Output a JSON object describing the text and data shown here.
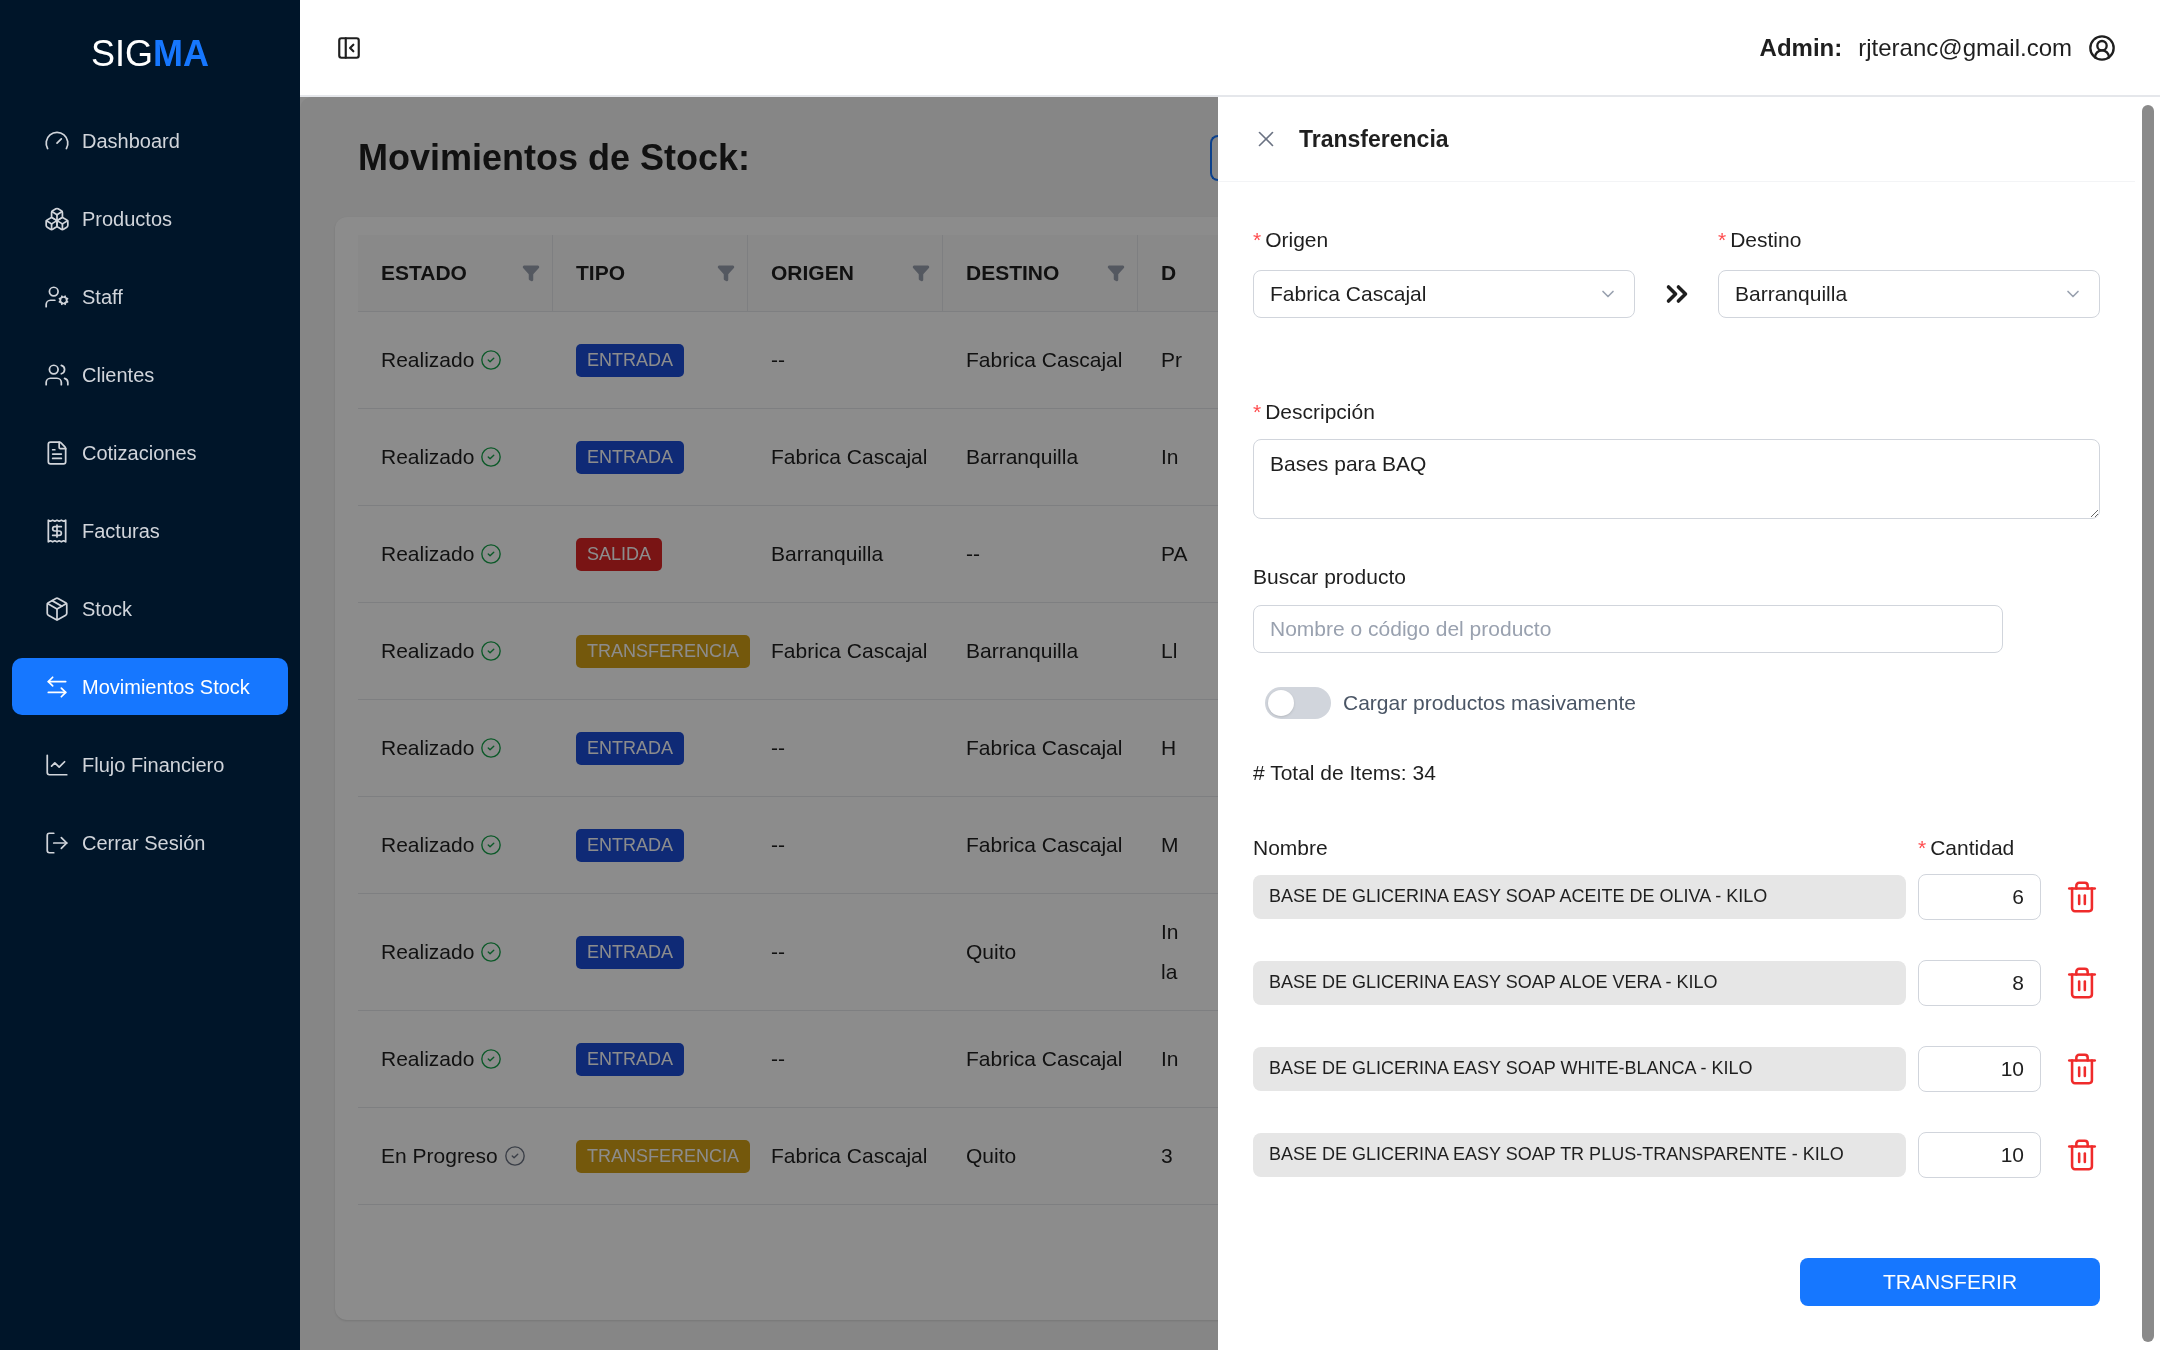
{
  "logo": {
    "plain": "SIG",
    "accent": "MA"
  },
  "sidebar": {
    "items": [
      {
        "label": "Dashboard",
        "selected": false
      },
      {
        "label": "Productos",
        "selected": false
      },
      {
        "label": "Staff",
        "selected": false
      },
      {
        "label": "Clientes",
        "selected": false
      },
      {
        "label": "Cotizaciones",
        "selected": false
      },
      {
        "label": "Facturas",
        "selected": false
      },
      {
        "label": "Stock",
        "selected": false
      },
      {
        "label": "Movimientos Stock",
        "selected": true
      },
      {
        "label": "Flujo Financiero",
        "selected": false
      },
      {
        "label": "Cerrar Sesión",
        "selected": false
      }
    ]
  },
  "top_bar": {
    "role": "Admin:",
    "email": "rjteranc@gmail.com"
  },
  "page": {
    "title": "Movimientos de Stock:"
  },
  "table": {
    "columns": [
      "ESTADO",
      "TIPO",
      "ORIGEN",
      "DESTINO",
      "D"
    ],
    "rows": [
      {
        "estado": "Realizado",
        "completed": true,
        "tipo": "ENTRADA",
        "kind": "in",
        "origen": "--",
        "destino": "Fabrica Cascajal",
        "column_5": "Pr"
      },
      {
        "estado": "Realizado",
        "completed": true,
        "tipo": "ENTRADA",
        "kind": "in",
        "origen": "Fabrica Cascajal",
        "destino": "Barranquilla",
        "column_5": "In"
      },
      {
        "estado": "Realizado",
        "completed": true,
        "tipo": "SALIDA",
        "kind": "out",
        "origen": "Barranquilla",
        "destino": "--",
        "column_5": "PA"
      },
      {
        "estado": "Realizado",
        "completed": true,
        "tipo": "TRANSFERENCIA",
        "kind": "transfer",
        "origen": "Fabrica Cascajal",
        "destino": "Barranquilla",
        "column_5": "Ll"
      },
      {
        "estado": "Realizado",
        "completed": true,
        "tipo": "ENTRADA",
        "kind": "in",
        "origen": "--",
        "destino": "Fabrica Cascajal",
        "column_5": "H"
      },
      {
        "estado": "Realizado",
        "completed": true,
        "tipo": "ENTRADA",
        "kind": "in",
        "origen": "--",
        "destino": "Fabrica Cascajal",
        "column_5": "M"
      },
      {
        "estado": "Realizado",
        "completed": true,
        "tipo": "ENTRADA",
        "kind": "in",
        "origen": "--",
        "destino": "Quito",
        "column_5": "In\nla"
      },
      {
        "estado": "Realizado",
        "completed": true,
        "tipo": "ENTRADA",
        "kind": "in",
        "origen": "--",
        "destino": "Fabrica Cascajal",
        "column_5": "In"
      },
      {
        "estado": "En Progreso",
        "completed": false,
        "tipo": "TRANSFERENCIA",
        "kind": "transfer",
        "origen": "Fabrica Cascajal",
        "destino": "Quito",
        "column_5": "3"
      }
    ]
  },
  "drawer": {
    "title": "Transferencia",
    "origen": {
      "label": "Origen",
      "required": true,
      "required_mark": "*",
      "value": "Fabrica Cascajal"
    },
    "destino": {
      "label": "Destino",
      "required": true,
      "required_mark": "*",
      "value": "Barranquilla"
    },
    "descripcion": {
      "label": "Descripción",
      "required": true,
      "required_mark": "*",
      "value": "Bases para BAQ"
    },
    "buscar": {
      "label": "Buscar producto",
      "placeholder": "Nombre o código del producto"
    },
    "bulk_toggle": {
      "label": "Cargar productos masivamente",
      "on": false
    },
    "total": "# Total de Items: 34",
    "items_header": {
      "name": "Nombre",
      "quantity": "Cantidad",
      "quantity_required": true,
      "quantity_required_mark": "*"
    },
    "items": [
      {
        "name": "BASE DE GLICERINA EASY SOAP ACEITE DE OLIVA - KILO",
        "quantity": "6"
      },
      {
        "name": "BASE DE GLICERINA EASY SOAP ALOE VERA - KILO",
        "quantity": "8"
      },
      {
        "name": "BASE DE GLICERINA EASY SOAP WHITE-BLANCA - KILO",
        "quantity": "10"
      },
      {
        "name": "BASE DE GLICERINA EASY SOAP TR PLUS-TRANSPARENTE - KILO",
        "quantity": "10"
      }
    ],
    "submit": "TRANSFERIR"
  }
}
